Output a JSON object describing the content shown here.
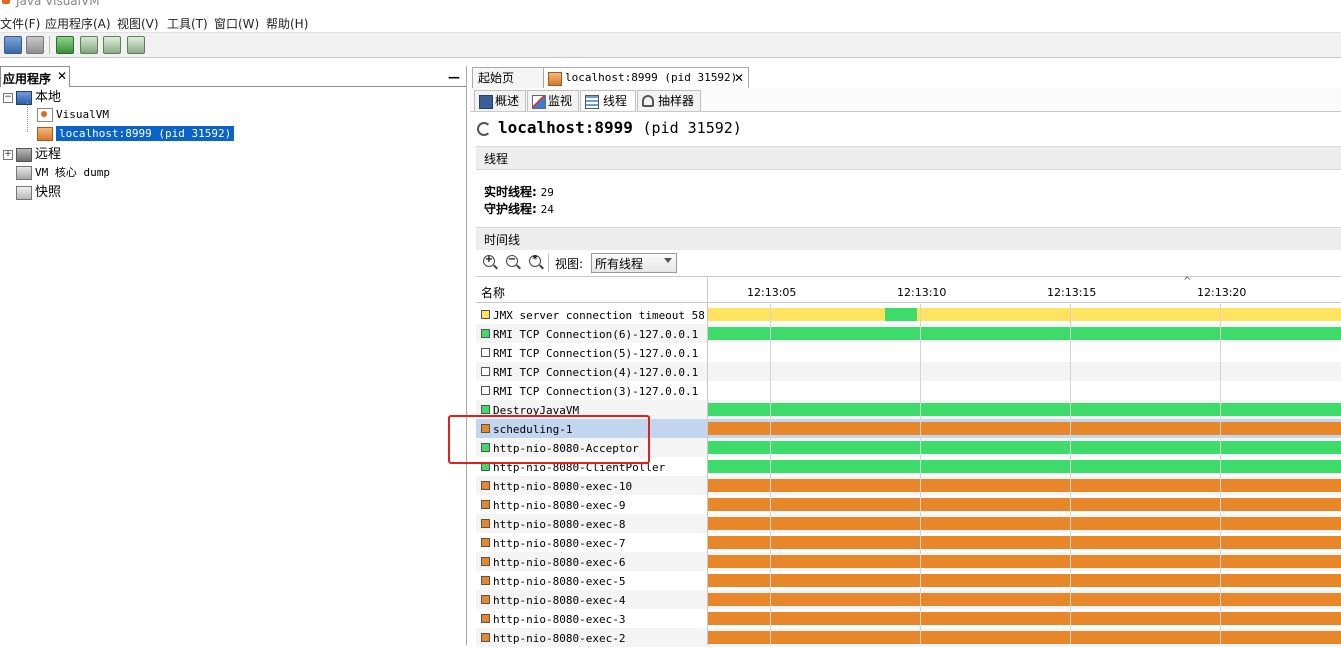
{
  "window": {
    "title": "Java VisualVM"
  },
  "menu": [
    "文件(F)",
    "应用程序(A)",
    "视图(V)",
    "工具(T)",
    "窗口(W)",
    "帮助(H)"
  ],
  "toolbar": {
    "buttons": [
      "load-snapshot-icon",
      "save-snapshot-icon",
      "add-jmx-connection-icon",
      "add-jmx-local-icon",
      "add-remote-host-icon",
      "add-vm-coredump-icon"
    ]
  },
  "left_panel": {
    "tab_label": "应用程序",
    "close": "✕",
    "minimize": "—",
    "tree": [
      {
        "label": "本地",
        "level": 0,
        "expanded": true,
        "icon": "computer-icon"
      },
      {
        "label": "VisualVM",
        "level": 1,
        "icon": "visualvm-icon"
      },
      {
        "label": "localhost:8999 (pid 31592)",
        "level": 1,
        "icon": "jmx-icon",
        "selected": true
      },
      {
        "label": "远程",
        "level": 0,
        "icon": "remote-host-icon"
      },
      {
        "label": "VM 核心 dump",
        "level": 0,
        "icon": "coredump-icon"
      },
      {
        "label": "快照",
        "level": 0,
        "icon": "snapshot-icon"
      }
    ]
  },
  "doc_tabs": [
    {
      "label": "起始页",
      "active": false
    },
    {
      "label": "localhost:8999 (pid 31592)",
      "active": true,
      "close": "✕"
    }
  ],
  "sub_tabs": [
    {
      "label": "概述",
      "icon": "overview-icon"
    },
    {
      "label": "监视",
      "icon": "monitor-icon"
    },
    {
      "label": "线程",
      "icon": "threads-icon",
      "active": true
    },
    {
      "label": "抽样器",
      "icon": "sampler-icon"
    }
  ],
  "header": {
    "host": "localhost:8999",
    "pid": "(pid 31592)"
  },
  "threads_section": {
    "title": "线程",
    "live_label": "实时线程:",
    "live_value": "29",
    "daemon_label": "守护线程:",
    "daemon_value": "24"
  },
  "timeline": {
    "title": "时间线",
    "view_label": "视图:",
    "view_value": "所有线程",
    "name_col": "名称",
    "ticks": [
      "12:13:05",
      "12:13:10",
      "12:13:15",
      "12:13:20"
    ]
  },
  "colors": {
    "running": "#3ddc6a",
    "sleeping": "#ffe35e",
    "wait": "#e8862a",
    "none": "#ffffff",
    "selection": "#c2d7ef",
    "highlight_box": "#e0201b"
  },
  "threads": [
    {
      "name": "JMX server connection timeout 58",
      "state": "sleeping",
      "segments": [
        {
          "state": "sleeping",
          "from": 0,
          "to": 0.28
        },
        {
          "state": "running",
          "from": 0.28,
          "to": 0.33
        },
        {
          "state": "sleeping",
          "from": 0.33,
          "to": 1
        }
      ]
    },
    {
      "name": "RMI TCP Connection(6)-127.0.0.1",
      "state": "running",
      "segments": [
        {
          "state": "running",
          "from": 0,
          "to": 1
        }
      ]
    },
    {
      "name": "RMI TCP Connection(5)-127.0.0.1",
      "state": "none",
      "segments": []
    },
    {
      "name": "RMI TCP Connection(4)-127.0.0.1",
      "state": "none",
      "segments": []
    },
    {
      "name": "RMI TCP Connection(3)-127.0.0.1",
      "state": "none",
      "segments": []
    },
    {
      "name": "DestroyJavaVM",
      "state": "running",
      "segments": [
        {
          "state": "running",
          "from": 0,
          "to": 1
        }
      ]
    },
    {
      "name": "scheduling-1",
      "state": "wait",
      "selected": true,
      "segments": [
        {
          "state": "wait",
          "from": 0,
          "to": 1
        }
      ]
    },
    {
      "name": "http-nio-8080-Acceptor",
      "state": "running",
      "segments": [
        {
          "state": "running",
          "from": 0,
          "to": 1
        }
      ]
    },
    {
      "name": "http-nio-8080-ClientPoller",
      "state": "running",
      "segments": [
        {
          "state": "running",
          "from": 0,
          "to": 1
        }
      ]
    },
    {
      "name": "http-nio-8080-exec-10",
      "state": "wait",
      "segments": [
        {
          "state": "wait",
          "from": 0,
          "to": 1
        }
      ]
    },
    {
      "name": "http-nio-8080-exec-9",
      "state": "wait",
      "segments": [
        {
          "state": "wait",
          "from": 0,
          "to": 1
        }
      ]
    },
    {
      "name": "http-nio-8080-exec-8",
      "state": "wait",
      "segments": [
        {
          "state": "wait",
          "from": 0,
          "to": 1
        }
      ]
    },
    {
      "name": "http-nio-8080-exec-7",
      "state": "wait",
      "segments": [
        {
          "state": "wait",
          "from": 0,
          "to": 1
        }
      ]
    },
    {
      "name": "http-nio-8080-exec-6",
      "state": "wait",
      "segments": [
        {
          "state": "wait",
          "from": 0,
          "to": 1
        }
      ]
    },
    {
      "name": "http-nio-8080-exec-5",
      "state": "wait",
      "segments": [
        {
          "state": "wait",
          "from": 0,
          "to": 1
        }
      ]
    },
    {
      "name": "http-nio-8080-exec-4",
      "state": "wait",
      "segments": [
        {
          "state": "wait",
          "from": 0,
          "to": 1
        }
      ]
    },
    {
      "name": "http-nio-8080-exec-3",
      "state": "wait",
      "segments": [
        {
          "state": "wait",
          "from": 0,
          "to": 1
        }
      ]
    },
    {
      "name": "http-nio-8080-exec-2",
      "state": "wait",
      "segments": [
        {
          "state": "wait",
          "from": 0,
          "to": 1
        }
      ]
    }
  ]
}
